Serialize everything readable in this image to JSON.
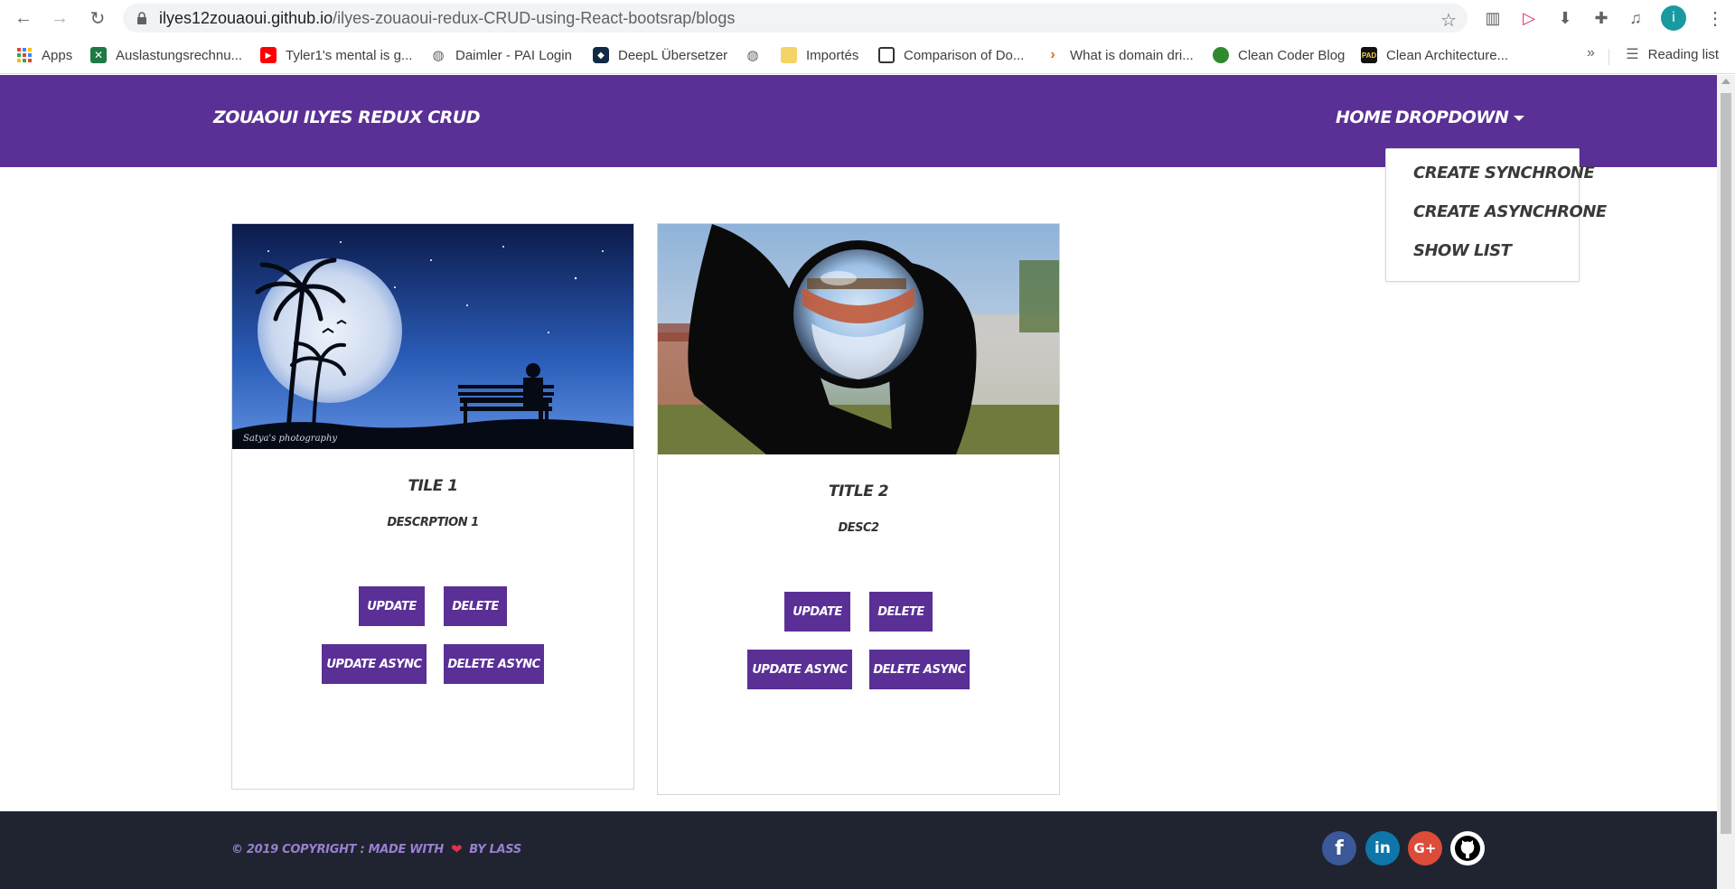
{
  "browser": {
    "url_host": "ilyes12zouaoui.github.io",
    "url_path": "/ilyes-zouaoui-redux-CRUD-using-React-bootsrap/blogs",
    "profile_initial": "i",
    "bookmarks": [
      {
        "label": "Apps",
        "icon": "apps-grid-icon"
      },
      {
        "label": "Auslastungsrechnu...",
        "icon": "excel-icon"
      },
      {
        "label": "Tyler1's mental is g...",
        "icon": "youtube-icon"
      },
      {
        "label": "Daimler - PAI Login",
        "icon": "globe-icon"
      },
      {
        "label": "DeepL Übersetzer",
        "icon": "deepl-icon"
      },
      {
        "label": "",
        "icon": "globe-icon"
      },
      {
        "label": "Importés",
        "icon": "folder-icon"
      },
      {
        "label": "Comparison of Do...",
        "icon": "site-icon"
      },
      {
        "label": "What is domain dri...",
        "icon": "chevron-site-icon"
      },
      {
        "label": "Clean Coder Blog",
        "icon": "clean-coder-icon"
      },
      {
        "label": "Clean Architecture...",
        "icon": "pad-icon"
      }
    ],
    "reading_list": "Reading list",
    "overflow": "»"
  },
  "navbar": {
    "brand": "Zouaoui Ilyes Redux CRUD",
    "home": "Home",
    "dropdown": "Dropdown",
    "menu": [
      "Create Synchrone",
      "Create Asynchrone",
      "Show List"
    ],
    "bg_color": "#5a3096"
  },
  "cards": [
    {
      "title": "Tile 1",
      "description": "Descrption 1",
      "image": "night-moon-palm-bench-image",
      "image_caption": "Satya's photography",
      "buttons": {
        "update": "Update",
        "delete": "Delete",
        "update_async": "Update Async",
        "delete_async": "Delete Async"
      }
    },
    {
      "title": "Title 2",
      "description": "desc2",
      "image": "crystal-ball-hand-image",
      "buttons": {
        "update": "Update",
        "delete": "Delete",
        "update_async": "Update Async",
        "delete_async": "Delete Async"
      }
    }
  ],
  "footer": {
    "copyright_left": "© 2019 Copyright : Made with",
    "copyright_right": "by Lass",
    "social": [
      {
        "name": "facebook",
        "glyph": "f",
        "color": "#3b5998"
      },
      {
        "name": "linkedin",
        "glyph": "in",
        "color": "#0e76a8"
      },
      {
        "name": "google-plus",
        "glyph": "G+",
        "color": "#dd4b39"
      },
      {
        "name": "github",
        "glyph": "",
        "color": "#000000"
      }
    ]
  }
}
